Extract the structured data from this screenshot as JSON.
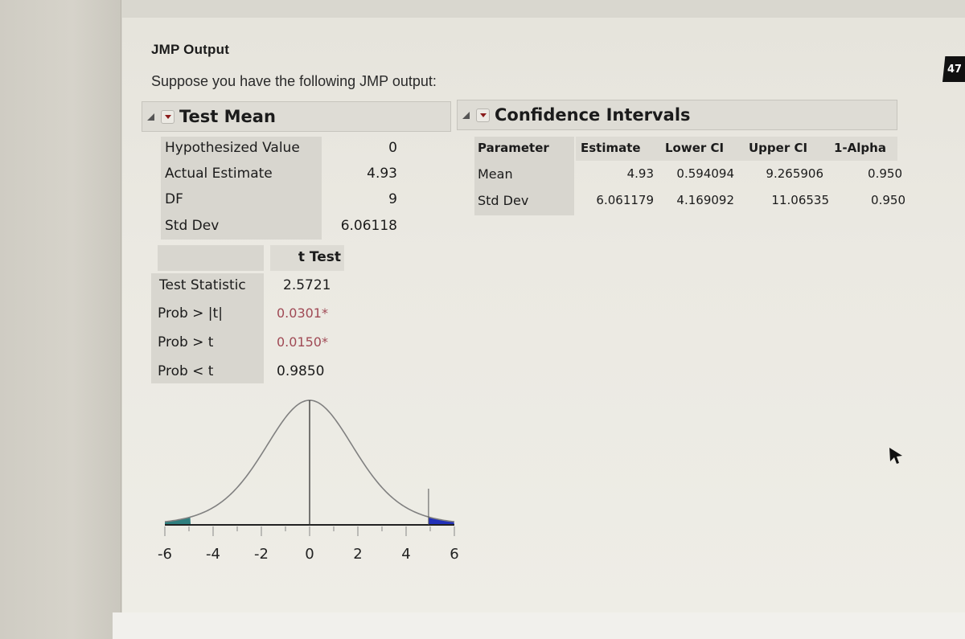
{
  "document": {
    "title": "JMP Output",
    "intro": "Suppose you have the following JMP output:",
    "page_badge": "47"
  },
  "test_mean": {
    "header": "Test Mean",
    "rows": [
      {
        "label": "Hypothesized Value",
        "value": "0"
      },
      {
        "label": "Actual Estimate",
        "value": "4.93"
      },
      {
        "label": "DF",
        "value": "9"
      },
      {
        "label": "Std Dev",
        "value": "6.06118"
      }
    ],
    "t_test": {
      "column_header": "t Test",
      "rows": [
        {
          "label": "Test Statistic",
          "value": "2.5721",
          "significant": false
        },
        {
          "label": "Prob > |t|",
          "value": "0.0301*",
          "significant": true
        },
        {
          "label": "Prob > t",
          "value": "0.0150*",
          "significant": true
        },
        {
          "label": "Prob < t",
          "value": "0.9850",
          "significant": false
        }
      ],
      "significant_color": "#a04a55"
    }
  },
  "confidence_intervals": {
    "header": "Confidence Intervals",
    "columns": [
      "Parameter",
      "Estimate",
      "Lower CI",
      "Upper CI",
      "1-Alpha"
    ],
    "rows": [
      [
        "Mean",
        "4.93",
        "0.594094",
        "9.265906",
        "0.950"
      ],
      [
        "Std Dev",
        "6.061179",
        "4.169092",
        "11.06535",
        "0.950"
      ]
    ]
  },
  "chart_data": {
    "type": "line",
    "title": "",
    "description": "t distribution density (DF 9) centered at hypothesized value 0, with shaded tails and estimate marker",
    "x_ticks": [
      -6,
      -4,
      -2,
      0,
      2,
      4,
      6
    ],
    "xlim": [
      -6,
      6
    ],
    "df": 9,
    "scale": 1.9167,
    "center": 0,
    "estimate_marker": 4.93,
    "shaded_tails": [
      {
        "from": -6,
        "to": -4.93,
        "color": "#2f7f7f"
      },
      {
        "from": 4.93,
        "to": 6,
        "color": "#2230b8"
      }
    ],
    "curve_color": "#808080",
    "grid": false,
    "legend": "none"
  }
}
